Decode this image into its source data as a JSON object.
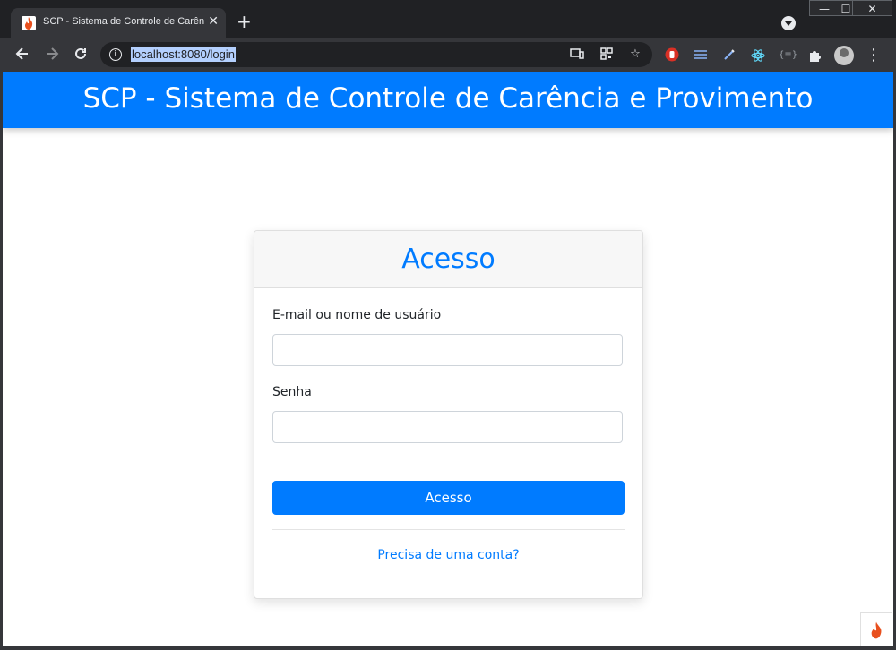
{
  "browser": {
    "tab": {
      "title": "SCP - Sistema de Controle de Carência e Provimento",
      "close": "✕"
    },
    "new_tab": "+",
    "window_controls": {
      "minimize": "—",
      "maximize": "☐",
      "close": "✕"
    },
    "address": "localhost:8080/login",
    "colors": {
      "frame": "#202124",
      "toolbar": "#35363a",
      "url_highlight": "#b3cffd"
    }
  },
  "page": {
    "header_title": "SCP - Sistema de Controle de Carência e Provimento",
    "card": {
      "title": "Acesso",
      "email_label": "E-mail ou nome de usuário",
      "email_value": "",
      "password_label": "Senha",
      "password_value": "",
      "submit_label": "Acesso",
      "register_link": "Precisa de uma conta?"
    },
    "colors": {
      "primary": "#007bff",
      "card_header_bg": "#f7f7f7"
    }
  }
}
